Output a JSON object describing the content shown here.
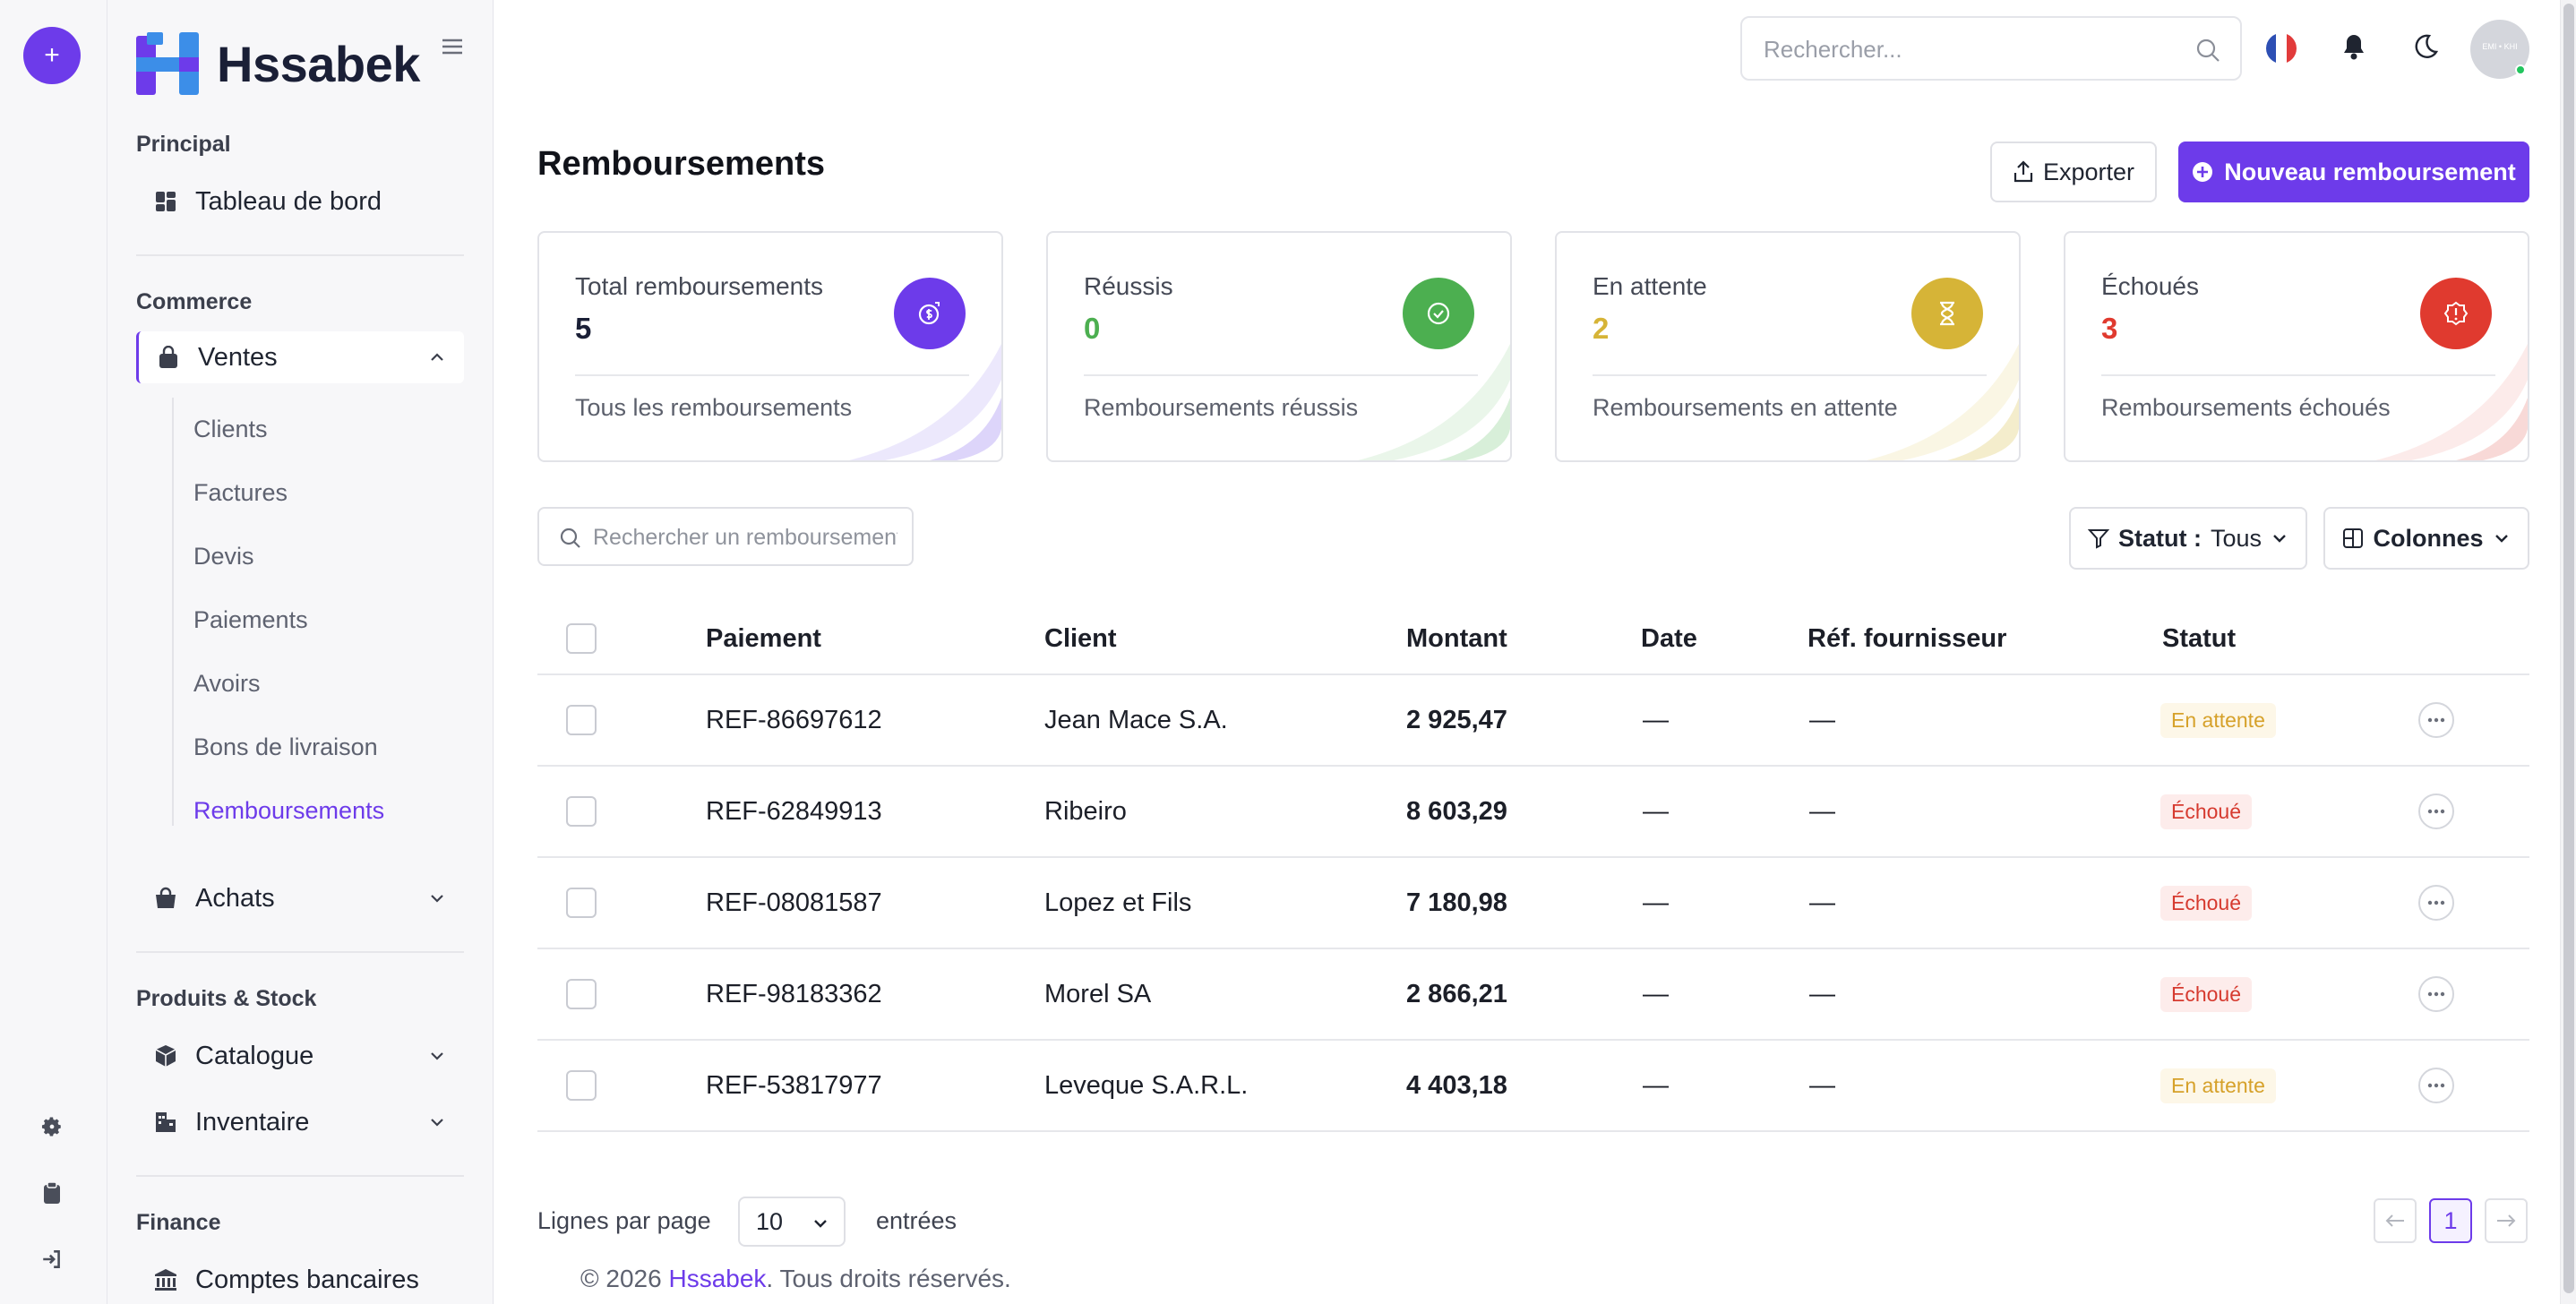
{
  "app": {
    "brand": "Hssabek"
  },
  "rail": {
    "plus_label": "+"
  },
  "sidebar": {
    "sections": [
      {
        "title": "Principal"
      },
      {
        "title": "Commerce"
      },
      {
        "title": "Produits & Stock"
      },
      {
        "title": "Finance"
      }
    ],
    "items": {
      "dashboard": "Tableau de bord",
      "ventes": "Ventes",
      "achats": "Achats",
      "catalogue": "Catalogue",
      "inventaire": "Inventaire",
      "comptes": "Comptes bancaires"
    },
    "ventes_sub": [
      "Clients",
      "Factures",
      "Devis",
      "Paiements",
      "Avoirs",
      "Bons de livraison",
      "Remboursements"
    ],
    "active_sub": "Remboursements"
  },
  "topbar": {
    "search_placeholder": "Rechercher...",
    "avatar_text": "EMI • KHI"
  },
  "page": {
    "title": "Remboursements",
    "export_label": "Exporter",
    "new_label": "Nouveau remboursement"
  },
  "cards": [
    {
      "label": "Total remboursements",
      "value": "5",
      "footer": "Tous les remboursements",
      "color": "#6d3bea",
      "icon": "refund-icon"
    },
    {
      "label": "Réussis",
      "value": "0",
      "footer": "Remboursements réussis",
      "color": "#4caf50",
      "icon": "check-circle-icon"
    },
    {
      "label": "En attente",
      "value": "2",
      "footer": "Remboursements en attente",
      "color": "#d6b437",
      "icon": "hourglass-icon"
    },
    {
      "label": "Échoués",
      "value": "3",
      "footer": "Remboursements échoués",
      "color": "#e03a2f",
      "icon": "alert-icon"
    }
  ],
  "toolbar": {
    "search_placeholder": "Rechercher un remboursement",
    "status_label": "Statut :",
    "status_value": "Tous",
    "columns_label": "Colonnes"
  },
  "table": {
    "columns": [
      "Paiement",
      "Client",
      "Montant",
      "Date",
      "Réf. fournisseur",
      "Statut"
    ],
    "rows": [
      {
        "payment": "REF-86697612",
        "client": "Jean Mace S.A.",
        "amount": "2 925,47",
        "date": "—",
        "ref": "—",
        "status": "En attente",
        "kind": "pending"
      },
      {
        "payment": "REF-62849913",
        "client": "Ribeiro",
        "amount": "8 603,29",
        "date": "—",
        "ref": "—",
        "status": "Échoué",
        "kind": "failed"
      },
      {
        "payment": "REF-08081587",
        "client": "Lopez et Fils",
        "amount": "7 180,98",
        "date": "—",
        "ref": "—",
        "status": "Échoué",
        "kind": "failed"
      },
      {
        "payment": "REF-98183362",
        "client": "Morel SA",
        "amount": "2 866,21",
        "date": "—",
        "ref": "—",
        "status": "Échoué",
        "kind": "failed"
      },
      {
        "payment": "REF-53817977",
        "client": "Leveque S.A.R.L.",
        "amount": "4 403,18",
        "date": "—",
        "ref": "—",
        "status": "En attente",
        "kind": "pending"
      }
    ]
  },
  "footer": {
    "rows_per_page_label": "Lignes par page",
    "rows_per_page_value": "10",
    "entries_label": "entrées",
    "current_page": "1",
    "copyright_prefix": "© 2026",
    "copyright_brand": "Hssabek",
    "copyright_suffix": ". Tous droits réservés."
  }
}
